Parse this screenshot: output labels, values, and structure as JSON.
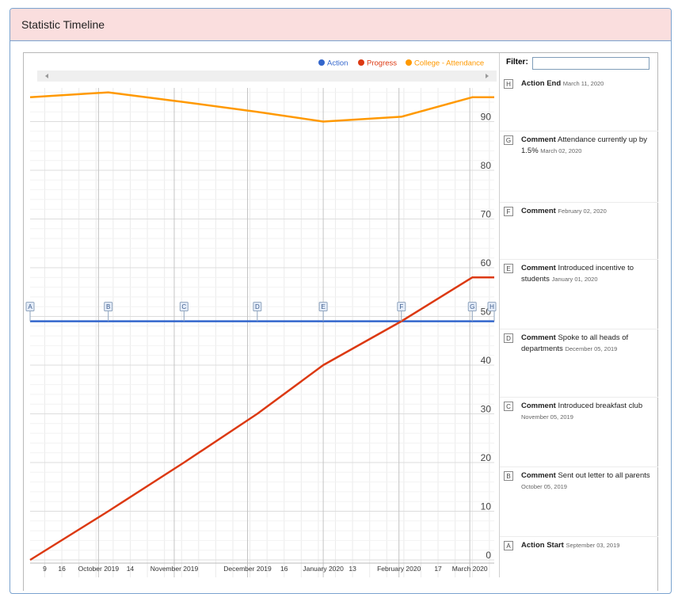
{
  "panel": {
    "title": "Statistic Timeline"
  },
  "filter": {
    "label": "Filter:",
    "value": ""
  },
  "legend": [
    {
      "name": "Action",
      "color": "#3366cc"
    },
    {
      "name": "Progress",
      "color": "#dc3912"
    },
    {
      "name": "College - Attendance",
      "color": "#ff9900"
    }
  ],
  "chart_data": {
    "type": "line",
    "ylim": [
      0,
      100
    ],
    "y_ticks": [
      0,
      10,
      20,
      30,
      40,
      50,
      60,
      70,
      80,
      90
    ],
    "x_range": [
      "2019-09-03",
      "2020-03-11"
    ],
    "x_tick_labels": [
      {
        "date": "2019-09-09",
        "label": "9"
      },
      {
        "date": "2019-09-16",
        "label": "16"
      },
      {
        "date": "2019-10-01",
        "label": "October 2019"
      },
      {
        "date": "2019-10-14",
        "label": "14"
      },
      {
        "date": "2019-11-01",
        "label": "November 2019"
      },
      {
        "date": "2019-12-01",
        "label": "December 2019"
      },
      {
        "date": "2019-12-16",
        "label": "16"
      },
      {
        "date": "2020-01-01",
        "label": "January 2020"
      },
      {
        "date": "2020-01-13",
        "label": "13"
      },
      {
        "date": "2020-02-01",
        "label": "February 2020"
      },
      {
        "date": "2020-02-17",
        "label": "17"
      },
      {
        "date": "2020-03-01",
        "label": "March 2020"
      }
    ],
    "series": [
      {
        "name": "Action",
        "color": "#3366cc",
        "points": [
          {
            "x": "2019-09-03",
            "y": 49
          },
          {
            "x": "2020-03-11",
            "y": 49
          }
        ]
      },
      {
        "name": "Progress",
        "color": "#dc3912",
        "points": [
          {
            "x": "2019-09-03",
            "y": 0
          },
          {
            "x": "2019-10-05",
            "y": 10
          },
          {
            "x": "2019-11-05",
            "y": 20
          },
          {
            "x": "2019-12-05",
            "y": 30
          },
          {
            "x": "2020-01-01",
            "y": 40
          },
          {
            "x": "2020-02-02",
            "y": 49
          },
          {
            "x": "2020-03-02",
            "y": 58
          },
          {
            "x": "2020-03-11",
            "y": 58
          }
        ]
      },
      {
        "name": "College - Attendance",
        "color": "#ff9900",
        "points": [
          {
            "x": "2019-09-03",
            "y": 95
          },
          {
            "x": "2019-10-05",
            "y": 96
          },
          {
            "x": "2019-11-05",
            "y": 94
          },
          {
            "x": "2019-12-05",
            "y": 92
          },
          {
            "x": "2020-01-01",
            "y": 90
          },
          {
            "x": "2020-02-02",
            "y": 91
          },
          {
            "x": "2020-03-02",
            "y": 95
          },
          {
            "x": "2020-03-11",
            "y": 95
          }
        ]
      }
    ],
    "annotations": [
      {
        "letter": "A",
        "date": "2019-09-03"
      },
      {
        "letter": "B",
        "date": "2019-10-05"
      },
      {
        "letter": "C",
        "date": "2019-11-05"
      },
      {
        "letter": "D",
        "date": "2019-12-05"
      },
      {
        "letter": "E",
        "date": "2020-01-01"
      },
      {
        "letter": "F",
        "date": "2020-02-02"
      },
      {
        "letter": "G",
        "date": "2020-03-02"
      },
      {
        "letter": "H",
        "date": "2020-03-11"
      }
    ]
  },
  "events": [
    {
      "letter": "H",
      "title": "Action End",
      "text": "",
      "date": "March 11, 2020"
    },
    {
      "letter": "G",
      "title": "Comment",
      "text": "Attendance currently up by 1.5%",
      "date": "March 02, 2020"
    },
    {
      "letter": "F",
      "title": "Comment",
      "text": "",
      "date": "February 02, 2020"
    },
    {
      "letter": "E",
      "title": "Comment",
      "text": "Introduced incentive to students",
      "date": "January 01, 2020"
    },
    {
      "letter": "D",
      "title": "Comment",
      "text": "Spoke to all heads of departments",
      "date": "December 05, 2019"
    },
    {
      "letter": "C",
      "title": "Comment",
      "text": "Introduced breakfast club",
      "date": "November 05, 2019"
    },
    {
      "letter": "B",
      "title": "Comment",
      "text": "Sent out letter to all parents",
      "date": "October 05, 2019"
    },
    {
      "letter": "A",
      "title": "Action Start",
      "text": "",
      "date": "September 03, 2019"
    }
  ]
}
